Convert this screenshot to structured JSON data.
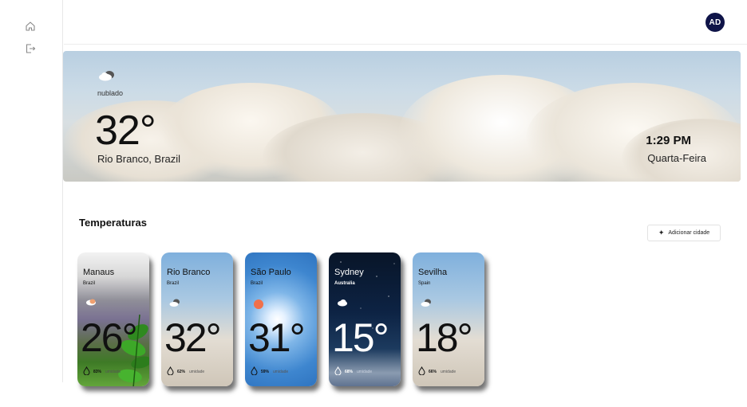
{
  "header": {
    "avatar_initials": "AD"
  },
  "sidebar": {
    "items": [
      {
        "icon": "home-icon"
      },
      {
        "icon": "logout-icon"
      }
    ]
  },
  "hero": {
    "condition": "nublado",
    "temperature": "32°",
    "location": "Rio Branco, Brazil",
    "time": "1:29 PM",
    "weekday": "Quarta-Feira",
    "icon": "cloud-icon"
  },
  "section": {
    "title": "Temperaturas",
    "add_city_label": "Adicionar cidade"
  },
  "cities": [
    {
      "name": "Manaus",
      "country": "Brazil",
      "temperature": "26°",
      "humidity": "83%",
      "humidity_label": "umidade",
      "icon": "rain-cloud-icon"
    },
    {
      "name": "Rio Branco",
      "country": "Brazil",
      "temperature": "32°",
      "humidity": "62%",
      "humidity_label": "umidade",
      "icon": "cloud-icon"
    },
    {
      "name": "São Paulo",
      "country": "Brazil",
      "temperature": "31°",
      "humidity": "59%",
      "humidity_label": "umidade",
      "icon": "sun-icon"
    },
    {
      "name": "Sydney",
      "country": "Australia",
      "temperature": "15°",
      "humidity": "68%",
      "humidity_label": "umidade",
      "icon": "cloud-icon"
    },
    {
      "name": "Sevilha",
      "country": "Spain",
      "temperature": "18°",
      "humidity": "66%",
      "humidity_label": "umidade",
      "icon": "cloud-icon"
    }
  ],
  "colors": {
    "avatar_bg": "#0f1448",
    "sun": "#f0704a",
    "night_sky": "#0c1e3c"
  }
}
